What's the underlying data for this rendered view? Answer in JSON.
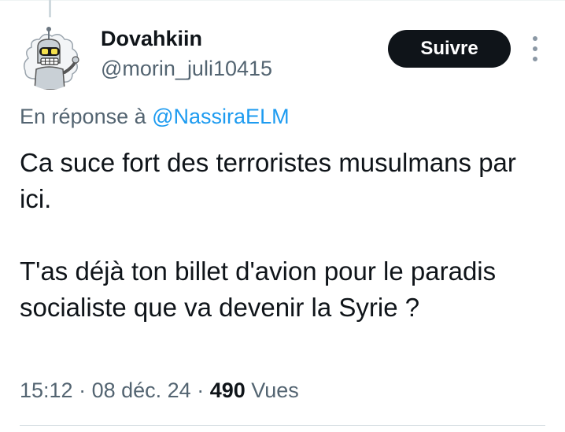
{
  "tweet": {
    "author": {
      "display_name": "Dovahkiin",
      "handle": "@morin_juli10415",
      "avatar_icon": "robot-avatar-icon"
    },
    "follow_label": "Suivre",
    "more_icon": "more-vertical-icon",
    "reply_prefix": "En réponse à ",
    "reply_to": "@NassiraELM",
    "paragraphs": [
      "Ca suce fort des terroristes musulmans par ici.",
      "T'as déjà ton billet d'avion pour le paradis socialiste que va devenir la Syrie ?"
    ],
    "time": "15:12",
    "separator": " · ",
    "date": "08 déc. 24",
    "views_count": "490",
    "views_label": " Vues"
  },
  "colors": {
    "text": "#0f1419",
    "secondary": "#536471",
    "link": "#1d9bf0",
    "button_bg": "#0f1419",
    "button_text": "#ffffff"
  }
}
